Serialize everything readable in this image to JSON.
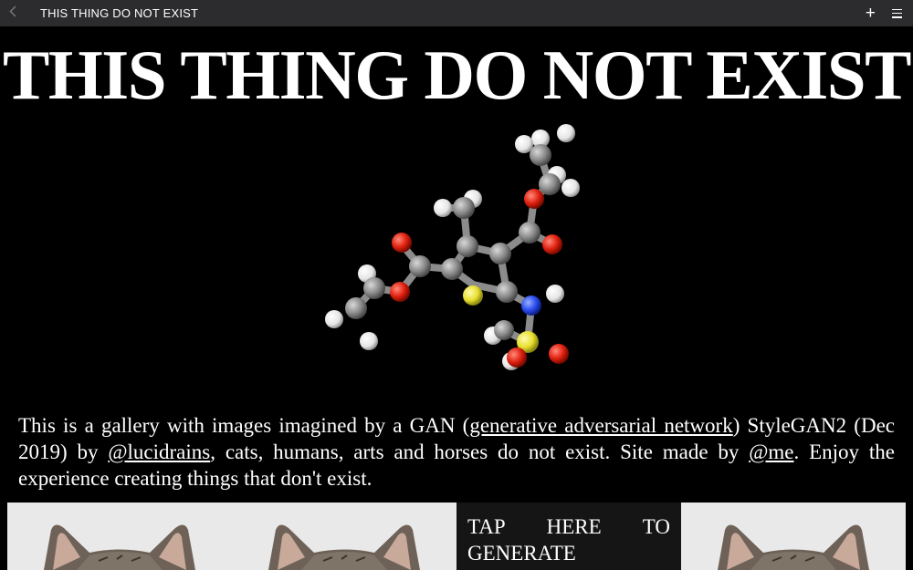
{
  "browser": {
    "tab_title": "THIS THING DO NOT EXIST"
  },
  "page": {
    "headline": "THIS THING DO NOT EXIST",
    "intro": {
      "text1": "This is a gallery with images imagined by a GAN (",
      "link1": "generative adversarial network",
      "text2": ") StyleGAN2 (Dec 2019) by ",
      "link2": "@lucidrains",
      "text3": ", cats, humans, arts and horses do not exist. Site made by ",
      "link3": "@me",
      "text4": ". Enjoy the experience creating things that don't exist."
    },
    "generate_tile": {
      "word1": "TAP",
      "word2": "HERE",
      "word3": "TO",
      "word4": "GENERATE"
    }
  },
  "colors": {
    "background": "#000000",
    "topbar": "#2c2c2e",
    "atom_carbon": "#8a8a8a",
    "atom_hydrogen": "#f2f2f2",
    "atom_oxygen": "#e0200f",
    "atom_nitrogen": "#2a4cf0",
    "atom_sulfur": "#e8e030"
  },
  "icons": {
    "back": "chevron-left-icon",
    "add": "plus-icon",
    "menu": "hamburger-menu-icon"
  }
}
